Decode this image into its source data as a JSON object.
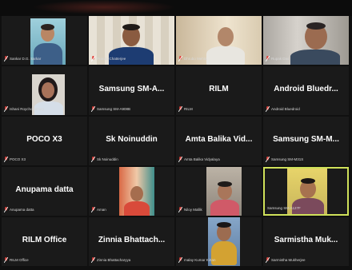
{
  "meeting": {
    "tiles": [
      {
        "display_name": "",
        "footer_label": "Sankar D.G. Sarkar",
        "has_video": true
      },
      {
        "display_name": "",
        "footer_label": "Pranav Chatterjee",
        "has_video": true
      },
      {
        "display_name": "",
        "footer_label": "Dhrubo Mehta",
        "has_video": true
      },
      {
        "display_name": "",
        "footer_label": "Rupak Das",
        "has_video": true
      },
      {
        "display_name": "",
        "footer_label": "Ishani Roychowdhury",
        "has_video": true
      },
      {
        "display_name": "Samsung SM-A...",
        "footer_label": "Samsung SM-A908B",
        "has_video": false
      },
      {
        "display_name": "RILM",
        "footer_label": "RILM",
        "has_video": false
      },
      {
        "display_name": "Android Bluedr...",
        "footer_label": "Android Bluedroid",
        "has_video": false
      },
      {
        "display_name": "POCO X3",
        "footer_label": "POCO X3",
        "has_video": false
      },
      {
        "display_name": "Sk Noinuddin",
        "footer_label": "Sk Noinuddin",
        "has_video": false
      },
      {
        "display_name": "Amta Balika Vid...",
        "footer_label": "Amta Balika Vidyalaya",
        "has_video": false
      },
      {
        "display_name": "Samsung SM-M...",
        "footer_label": "Samsung SM-M31S",
        "has_video": false
      },
      {
        "display_name": "Anupama datta",
        "footer_label": "Anupama datta",
        "has_video": false
      },
      {
        "display_name": "",
        "footer_label": "Aman",
        "has_video": true
      },
      {
        "display_name": "",
        "footer_label": "Niloy Mallik",
        "has_video": true
      },
      {
        "display_name": "",
        "footer_label": "Samsung SM-A127F",
        "has_video": true,
        "active_speaker": true
      },
      {
        "display_name": "RILM Office",
        "footer_label": "RILM Office",
        "has_video": false
      },
      {
        "display_name": "Zinnia Bhattach...",
        "footer_label": "Zinnia Bhattacharyya",
        "has_video": false
      },
      {
        "display_name": "",
        "footer_label": "malay Kumar Kirtan",
        "has_video": true
      },
      {
        "display_name": "Sarmistha Muk...",
        "footer_label": "Sarmistha Mukherjee",
        "has_video": false
      }
    ]
  },
  "colors": {
    "tile_bg": "#1a1a1a",
    "active_border": "#cfe15a",
    "muted_mic": "#e0403a",
    "name_text": "#ffffff"
  },
  "icons": {
    "footer": "muted-mic-icon"
  }
}
